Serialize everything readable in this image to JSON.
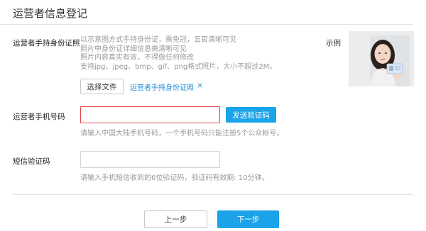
{
  "page": {
    "title": "运营者信息登记"
  },
  "id_photo": {
    "label": "运营者手持身份证照",
    "hints": [
      "以示意图方式手持身份证，需免冠，五官清晰可见",
      "照片中身份证详细信息需清晰可见",
      "照片内容真实有效，不得做任何修改",
      "支持jpg、jpeg、bmp、gif、png格式照片，大小不超过2M。"
    ],
    "choose_file_label": "选择文件",
    "file_name": "运营者手持身份证照",
    "remove_symbol": "×",
    "example_label": "示例"
  },
  "phone": {
    "label": "运营者手机号码",
    "value": "",
    "send_code_label": "发送验证码",
    "hint": "请输入中国大陆手机号码，一个手机号码只能注册5个公众帐号。"
  },
  "sms_code": {
    "label": "短信验证码",
    "value": "",
    "hint": "请输入手机短信收到的6位验证码，验证码有效期: 10分钟。"
  },
  "actions": {
    "prev_label": "上一步",
    "next_label": "下一步"
  },
  "colors": {
    "accent": "#1aa3e8",
    "error_border": "#e04b4b",
    "link": "#1d8fd6"
  }
}
